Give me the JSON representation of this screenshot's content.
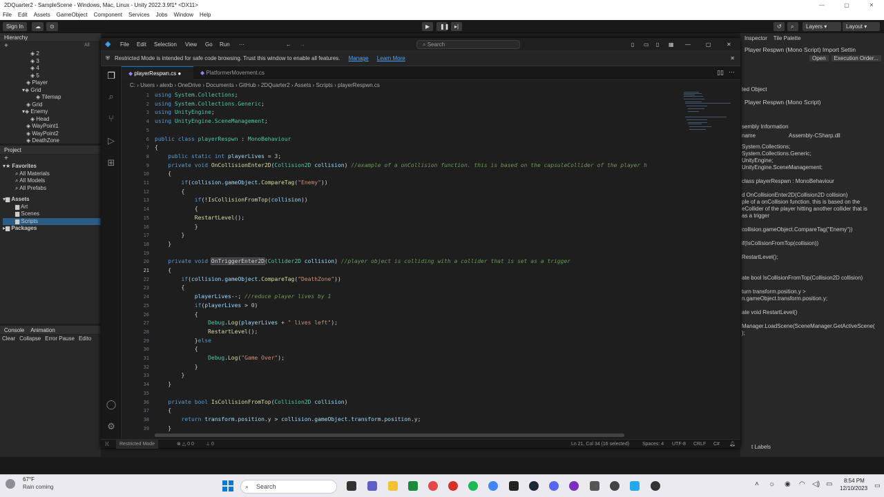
{
  "unity": {
    "title": "2DQuarter2 - SampleScene - Windows, Mac, Linux - Unity 2022.3.9f1* <DX11>",
    "menu": [
      "File",
      "Edit",
      "Assets",
      "GameObject",
      "Component",
      "Services",
      "Jobs",
      "Window",
      "Help"
    ],
    "signin": "Sign In",
    "layers": "Layers",
    "layout": "Layout",
    "hierarchy_tab": "Hierarchy",
    "hierarchy_search": "All",
    "hierarchy_items": [
      "2",
      "3",
      "4",
      "5",
      "Player",
      "Grid",
      "Tilemap",
      "Grid",
      "Enemy",
      "Head",
      "WayPoint1",
      "WayPoint2",
      "DeathZone"
    ],
    "project_tab": "Project",
    "favorites": "Favorites",
    "fav_items": [
      "All Materials",
      "All Models",
      "All Prefabs"
    ],
    "assets": "Assets",
    "asset_items": [
      "Art",
      "Scenes",
      "Scripts"
    ],
    "packages": "Packages",
    "console_tab": "Console",
    "animation_tab": "Animation",
    "console_tools": [
      "Clear",
      "Collapse",
      "Error Pause",
      "Edito"
    ],
    "inspector_tab": "Inspector",
    "tile_palette_tab": "Tile Palette",
    "insp_title": "Player Respwn (Mono Script) Import Settin",
    "open_btn": "Open",
    "exec_order_btn": "Execution Order...",
    "imported_object": "ted Object",
    "insp_script": "Player Respwn (Mono Script)",
    "assembly_info": "sembly Information",
    "name_label": "name",
    "assembly_value": "Assembly-CSharp.dll",
    "preview_lines": [
      "System.Collections;",
      "System.Collections.Generic;",
      "UnityEngine;",
      "UnityEngine.SceneManagement;",
      "",
      "class playerRespwn : MonoBehaviour",
      "",
      "d OnCollisionEnter2D(Collision2D collision)",
      "ple of a onCollision function. this is based on the",
      "eCollider of the player hitting another collider that is",
      "as a trigger",
      "",
      "collision.gameObject.CompareTag(\"Enemy\"))",
      "",
      "if(IsCollisionFromTop(collision))",
      "",
      "RestartLevel();",
      "",
      "",
      "ate bool IsCollisionFromTop(Collision2D collision)",
      "",
      "turn transform.position.y >",
      "n.gameObject.transform.position.y;",
      "",
      "ate void RestartLevel()",
      "",
      "Manager.LoadScene(SceneManager.GetActiveScene(",
      ");"
    ],
    "asset_labels": "t Labels"
  },
  "vscode": {
    "menu": [
      "File",
      "Edit",
      "Selection",
      "View",
      "Go",
      "Run",
      "···"
    ],
    "search": "Search",
    "banner_text": "Restricted Mode is intended for safe code browsing. Trust this window to enable all features.",
    "banner_manage": "Manage",
    "banner_learn": "Learn More",
    "tabs": [
      {
        "label": "playerRespwn.cs",
        "active": true,
        "dirty": true
      },
      {
        "label": "PlatformerMovement.cs",
        "active": false,
        "dirty": false
      }
    ],
    "breadcrumb": [
      "C:",
      "Users",
      "alexb",
      "OneDrive",
      "Documents",
      "GitHub",
      "2DQuarter2",
      "Assets",
      "Scripts",
      "playerRespwn.cs"
    ],
    "status_left": "Restricted Mode",
    "status_problems": "0  0",
    "status_ports": "0",
    "status_position": "Ln 21, Col 34 (16 selected)",
    "status_spaces": "Spaces: 4",
    "status_encoding": "UTF-8",
    "status_eol": "CRLF",
    "status_lang": "C#"
  },
  "code_lines": [
    [
      1,
      [
        [
          "kw",
          "using "
        ],
        [
          "ty",
          "System.Collections"
        ],
        [
          "pu",
          ";"
        ]
      ]
    ],
    [
      2,
      [
        [
          "kw",
          "using "
        ],
        [
          "ty",
          "System.Collections.Generic"
        ],
        [
          "pu",
          ";"
        ]
      ]
    ],
    [
      3,
      [
        [
          "kw",
          "using "
        ],
        [
          "ty",
          "UnityEngine"
        ],
        [
          "pu",
          ";"
        ]
      ]
    ],
    [
      4,
      [
        [
          "kw",
          "using "
        ],
        [
          "ty",
          "UnityEngine.SceneManagement"
        ],
        [
          "pu",
          ";"
        ]
      ]
    ],
    [
      5,
      []
    ],
    [
      6,
      [
        [
          "kw",
          "public class "
        ],
        [
          "ty",
          "playerRespwn"
        ],
        [
          "pu",
          " : "
        ],
        [
          "ty",
          "MonoBehaviour"
        ]
      ]
    ],
    [
      7,
      [
        [
          "pu",
          "{"
        ]
      ]
    ],
    [
      8,
      [
        [
          "pu",
          "    "
        ],
        [
          "kw",
          "public static int "
        ],
        [
          "va",
          "playerLives"
        ],
        [
          "pu",
          " = "
        ],
        [
          "nu",
          "3"
        ],
        [
          "pu",
          ";"
        ]
      ]
    ],
    [
      9,
      [
        [
          "pu",
          "    "
        ],
        [
          "kw",
          "private void "
        ],
        [
          "fn",
          "OnCollisionEnter2D"
        ],
        [
          "pu",
          "("
        ],
        [
          "ty",
          "Collision2D"
        ],
        [
          "va",
          " collision"
        ],
        [
          "pu",
          ") "
        ],
        [
          "cm",
          "//example of a onCollision function. this is based on the capsuleCollider of the player h"
        ]
      ]
    ],
    [
      10,
      [
        [
          "pu",
          "    {"
        ]
      ]
    ],
    [
      11,
      [
        [
          "pu",
          "        "
        ],
        [
          "kw",
          "if"
        ],
        [
          "pu",
          "("
        ],
        [
          "va",
          "collision"
        ],
        [
          "pu",
          "."
        ],
        [
          "va",
          "gameObject"
        ],
        [
          "pu",
          "."
        ],
        [
          "fn",
          "CompareTag"
        ],
        [
          "pu",
          "("
        ],
        [
          "st",
          "\"Enemy\""
        ],
        [
          "pu",
          "))"
        ]
      ]
    ],
    [
      12,
      [
        [
          "pu",
          "        {"
        ]
      ]
    ],
    [
      13,
      [
        [
          "pu",
          "            "
        ],
        [
          "kw",
          "if"
        ],
        [
          "pu",
          "(!"
        ],
        [
          "fn",
          "IsCollisionFromTop"
        ],
        [
          "pu",
          "("
        ],
        [
          "va",
          "collision"
        ],
        [
          "pu",
          "))"
        ]
      ]
    ],
    [
      14,
      [
        [
          "pu",
          "            {"
        ]
      ]
    ],
    [
      15,
      [
        [
          "pu",
          "            "
        ],
        [
          "fn",
          "RestartLevel"
        ],
        [
          "pu",
          "();"
        ]
      ]
    ],
    [
      16,
      [
        [
          "pu",
          "            }"
        ]
      ]
    ],
    [
      17,
      [
        [
          "pu",
          "        }"
        ]
      ]
    ],
    [
      18,
      [
        [
          "pu",
          "    }"
        ]
      ]
    ],
    [
      19,
      []
    ],
    [
      20,
      [
        [
          "pu",
          "    "
        ],
        [
          "kw",
          "private void "
        ],
        [
          "hl",
          "OnTriggerEnter2D"
        ],
        [
          "pu",
          "("
        ],
        [
          "ty",
          "Collider2D"
        ],
        [
          "va",
          " collision"
        ],
        [
          "pu",
          ") "
        ],
        [
          "cm",
          "//player object is colliding with a collider that is set as a trigger"
        ]
      ]
    ],
    [
      21,
      [
        [
          "pu",
          "    {"
        ]
      ]
    ],
    [
      22,
      [
        [
          "pu",
          "        "
        ],
        [
          "kw",
          "if"
        ],
        [
          "pu",
          "("
        ],
        [
          "va",
          "collision"
        ],
        [
          "pu",
          "."
        ],
        [
          "va",
          "gameObject"
        ],
        [
          "pu",
          "."
        ],
        [
          "fn",
          "CompareTag"
        ],
        [
          "pu",
          "("
        ],
        [
          "st",
          "\"DeathZone\""
        ],
        [
          "pu",
          "))"
        ]
      ]
    ],
    [
      23,
      [
        [
          "pu",
          "        {"
        ]
      ]
    ],
    [
      24,
      [
        [
          "pu",
          "            "
        ],
        [
          "va",
          "playerLives"
        ],
        [
          "pu",
          "--; "
        ],
        [
          "cm",
          "//reduce player lives by 1"
        ]
      ]
    ],
    [
      25,
      [
        [
          "pu",
          "            "
        ],
        [
          "kw",
          "if"
        ],
        [
          "pu",
          "("
        ],
        [
          "va",
          "playerLives"
        ],
        [
          "pu",
          " > "
        ],
        [
          "nu",
          "0"
        ],
        [
          "pu",
          ")"
        ]
      ]
    ],
    [
      26,
      [
        [
          "pu",
          "            {"
        ]
      ]
    ],
    [
      27,
      [
        [
          "pu",
          "                "
        ],
        [
          "ty",
          "Debug"
        ],
        [
          "pu",
          "."
        ],
        [
          "fn",
          "Log"
        ],
        [
          "pu",
          "("
        ],
        [
          "va",
          "playerLives"
        ],
        [
          "pu",
          " + "
        ],
        [
          "st",
          "\" lives left\""
        ],
        [
          "pu",
          ");"
        ]
      ]
    ],
    [
      28,
      [
        [
          "pu",
          "                "
        ],
        [
          "fn",
          "RestartLevel"
        ],
        [
          "pu",
          "();"
        ]
      ]
    ],
    [
      29,
      [
        [
          "pu",
          "            }"
        ],
        [
          "kw",
          "else"
        ]
      ]
    ],
    [
      30,
      [
        [
          "pu",
          "            {"
        ]
      ]
    ],
    [
      31,
      [
        [
          "pu",
          "                "
        ],
        [
          "ty",
          "Debug"
        ],
        [
          "pu",
          "."
        ],
        [
          "fn",
          "Log"
        ],
        [
          "pu",
          "("
        ],
        [
          "st",
          "\"Game Over\""
        ],
        [
          "pu",
          ");"
        ]
      ]
    ],
    [
      32,
      [
        [
          "pu",
          "            }"
        ]
      ]
    ],
    [
      33,
      [
        [
          "pu",
          "        }"
        ]
      ]
    ],
    [
      34,
      [
        [
          "pu",
          "    }"
        ]
      ]
    ],
    [
      35,
      []
    ],
    [
      36,
      [
        [
          "pu",
          "    "
        ],
        [
          "kw",
          "private bool "
        ],
        [
          "fn",
          "IsCollisionFromTop"
        ],
        [
          "pu",
          "("
        ],
        [
          "ty",
          "Collision2D"
        ],
        [
          "va",
          " collision"
        ],
        [
          "pu",
          ")"
        ]
      ]
    ],
    [
      37,
      [
        [
          "pu",
          "    {"
        ]
      ]
    ],
    [
      38,
      [
        [
          "pu",
          "        "
        ],
        [
          "kw",
          "return "
        ],
        [
          "va",
          "transform"
        ],
        [
          "pu",
          "."
        ],
        [
          "va",
          "position"
        ],
        [
          "pu",
          "."
        ],
        [
          "va",
          "y"
        ],
        [
          "pu",
          " > "
        ],
        [
          "va",
          "collision"
        ],
        [
          "pu",
          "."
        ],
        [
          "va",
          "gameObject"
        ],
        [
          "pu",
          "."
        ],
        [
          "va",
          "transform"
        ],
        [
          "pu",
          "."
        ],
        [
          "va",
          "position"
        ],
        [
          "pu",
          "."
        ],
        [
          "va",
          "y"
        ],
        [
          "pu",
          ";"
        ]
      ]
    ],
    [
      39,
      [
        [
          "pu",
          "    }"
        ]
      ]
    ]
  ],
  "line_numbers": [
    "1",
    "2",
    "3",
    "4",
    "5",
    "6",
    "7",
    "8",
    "9",
    "10",
    "11",
    "12",
    "13",
    "14",
    "15",
    "16",
    "17",
    "18",
    "19",
    "20",
    "21",
    "22",
    "23",
    "24",
    "25",
    "26",
    "27",
    "28",
    "29",
    "30",
    "31",
    "32",
    "33",
    "34",
    "35",
    "36",
    "37",
    "38",
    "39"
  ],
  "taskbar": {
    "weather_temp": "67°F",
    "weather_text": "Rain coming",
    "search": "Search",
    "time": "8:54 PM",
    "date": "12/10/2023"
  },
  "colors": {
    "accent": "#007acc",
    "keyword": "#569cd6",
    "type": "#4ec9b0",
    "function": "#dcdcaa",
    "string": "#ce9178",
    "comment": "#6a9955"
  }
}
